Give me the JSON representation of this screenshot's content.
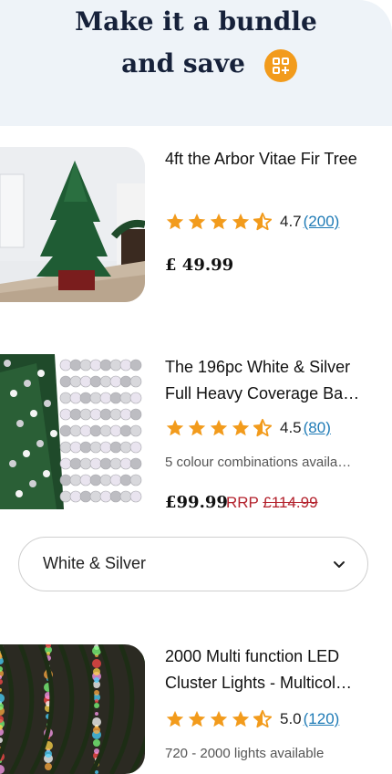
{
  "header": {
    "title_line1": "Make it a bundle",
    "title_line2": "and save",
    "badge_icon": "bundle-grid-plus-icon",
    "accent": "#f29b1c"
  },
  "products": [
    {
      "name": "4ft the Arbor Vitae Fir Tree",
      "rating": "4.7",
      "review_count": "(200)",
      "stars": 4.5,
      "price": "£ 49.99",
      "image": "christmas-tree-in-room"
    },
    {
      "name": "The 196pc White & Silver Full Heavy Coverage Ba…",
      "rating": "4.5",
      "review_count": "(80)",
      "stars": 4.5,
      "subtitle": "5 colour combinations availa…",
      "price": "£99.99",
      "rrp_label": "RRP",
      "rrp_price": "£114.99",
      "image": "white-silver-baubles",
      "variant_select": {
        "value": "White & Silver"
      }
    },
    {
      "name": "2000 Multi function LED Cluster Lights - Multicol…",
      "rating": "5.0",
      "review_count": "(120)",
      "stars": 4.5,
      "subtitle": "720 - 2000 lights available",
      "image": "multicolour-led-cluster-lights"
    }
  ],
  "colors": {
    "star": "#f29b1c",
    "link": "#1f7bb6",
    "rrp": "#b3212c"
  }
}
